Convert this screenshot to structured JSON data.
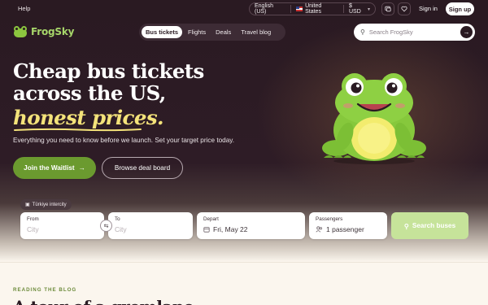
{
  "topbar": {
    "help": "Help",
    "language": "English (US)",
    "country": "United States",
    "currency": "$ USD",
    "sign_in": "Sign in",
    "sign_up": "Sign up"
  },
  "brand": {
    "name": "FrogSky",
    "accent": "#8cc63f"
  },
  "nav": {
    "tabs": [
      {
        "label": "Bus tickets",
        "active": true
      },
      {
        "label": "Flights",
        "active": false
      },
      {
        "label": "Deals",
        "active": false
      },
      {
        "label": "Travel blog",
        "active": false
      }
    ],
    "search_placeholder": "Search FrogSky"
  },
  "hero": {
    "headline": "Cheap bus tickets across the US,",
    "headline_accent": "honest prices.",
    "subtitle": "Everything you need to know before we launch. Set your target price today.",
    "primary_cta": "Join the Waitlist",
    "secondary_cta": "Browse deal board"
  },
  "booking": {
    "region_badge": "Türkiye intercity",
    "from_label": "From",
    "from_placeholder": "City",
    "to_label": "To",
    "to_placeholder": "City",
    "depart_label": "Depart",
    "depart_value": "Fri, May 22",
    "passengers_label": "Passengers",
    "passengers_value": "1 passenger",
    "search_button": "Search buses"
  },
  "blog": {
    "eyebrow": "READING THE BLOG",
    "title": "A tour of a gremlane"
  },
  "colors": {
    "hero_bg": "#2a1a22",
    "primary_green": "#6b9a2f",
    "accent_yellow": "#f4e37a"
  }
}
